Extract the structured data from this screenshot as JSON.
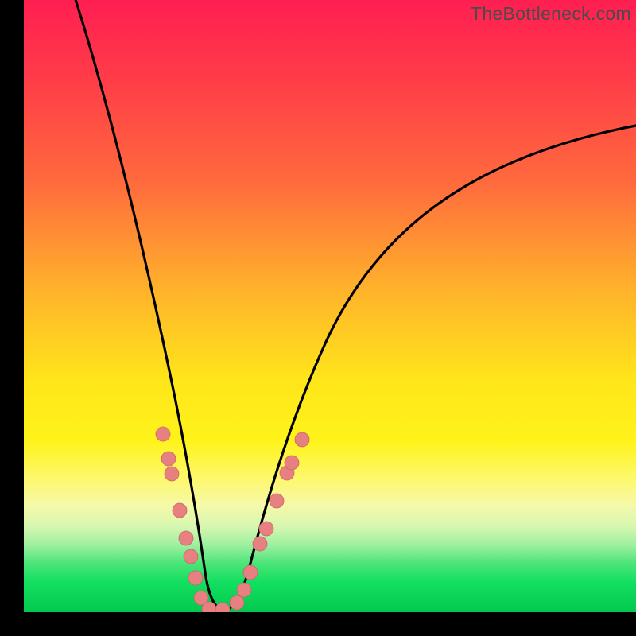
{
  "watermark": {
    "text": "TheBottleneck.com"
  },
  "chart_data": {
    "type": "line",
    "title": "",
    "xlabel": "",
    "ylabel": "",
    "xlim": [
      0,
      100
    ],
    "ylim": [
      0,
      100
    ],
    "series": [
      {
        "name": "left-curve",
        "x": [
          8,
          12,
          16,
          20,
          24,
          26,
          28,
          29,
          30
        ],
        "y": [
          100,
          80,
          60,
          40,
          20,
          10,
          3,
          0.5,
          0
        ]
      },
      {
        "name": "right-curve",
        "x": [
          34,
          36,
          40,
          46,
          54,
          64,
          76,
          88,
          100
        ],
        "y": [
          0,
          3,
          12,
          28,
          45,
          59,
          69,
          75,
          79
        ]
      }
    ],
    "markers": {
      "name": "bead-markers",
      "color": "#e78080",
      "points": [
        {
          "x": 22.7,
          "y": 29
        },
        {
          "x": 23.6,
          "y": 25
        },
        {
          "x": 24.2,
          "y": 22.5
        },
        {
          "x": 25.5,
          "y": 16.5
        },
        {
          "x": 26.5,
          "y": 12
        },
        {
          "x": 27.2,
          "y": 9
        },
        {
          "x": 28.0,
          "y": 5.5
        },
        {
          "x": 29.0,
          "y": 2.2
        },
        {
          "x": 30.2,
          "y": 0.4
        },
        {
          "x": 32.5,
          "y": 0.3
        },
        {
          "x": 34.8,
          "y": 1.4
        },
        {
          "x": 36.0,
          "y": 3.5
        },
        {
          "x": 37.0,
          "y": 6.3
        },
        {
          "x": 38.6,
          "y": 11
        },
        {
          "x": 39.6,
          "y": 13.5
        },
        {
          "x": 41.3,
          "y": 18
        },
        {
          "x": 43.0,
          "y": 22.5
        },
        {
          "x": 43.7,
          "y": 24.2
        },
        {
          "x": 45.4,
          "y": 28
        }
      ]
    },
    "background": {
      "gradient_stops": [
        {
          "pos": 0.0,
          "color": "#ff1f52"
        },
        {
          "pos": 0.3,
          "color": "#ff6b3d"
        },
        {
          "pos": 0.62,
          "color": "#ffe51a"
        },
        {
          "pos": 0.86,
          "color": "#d7f7b0"
        },
        {
          "pos": 1.0,
          "color": "#02c94e"
        }
      ]
    }
  }
}
